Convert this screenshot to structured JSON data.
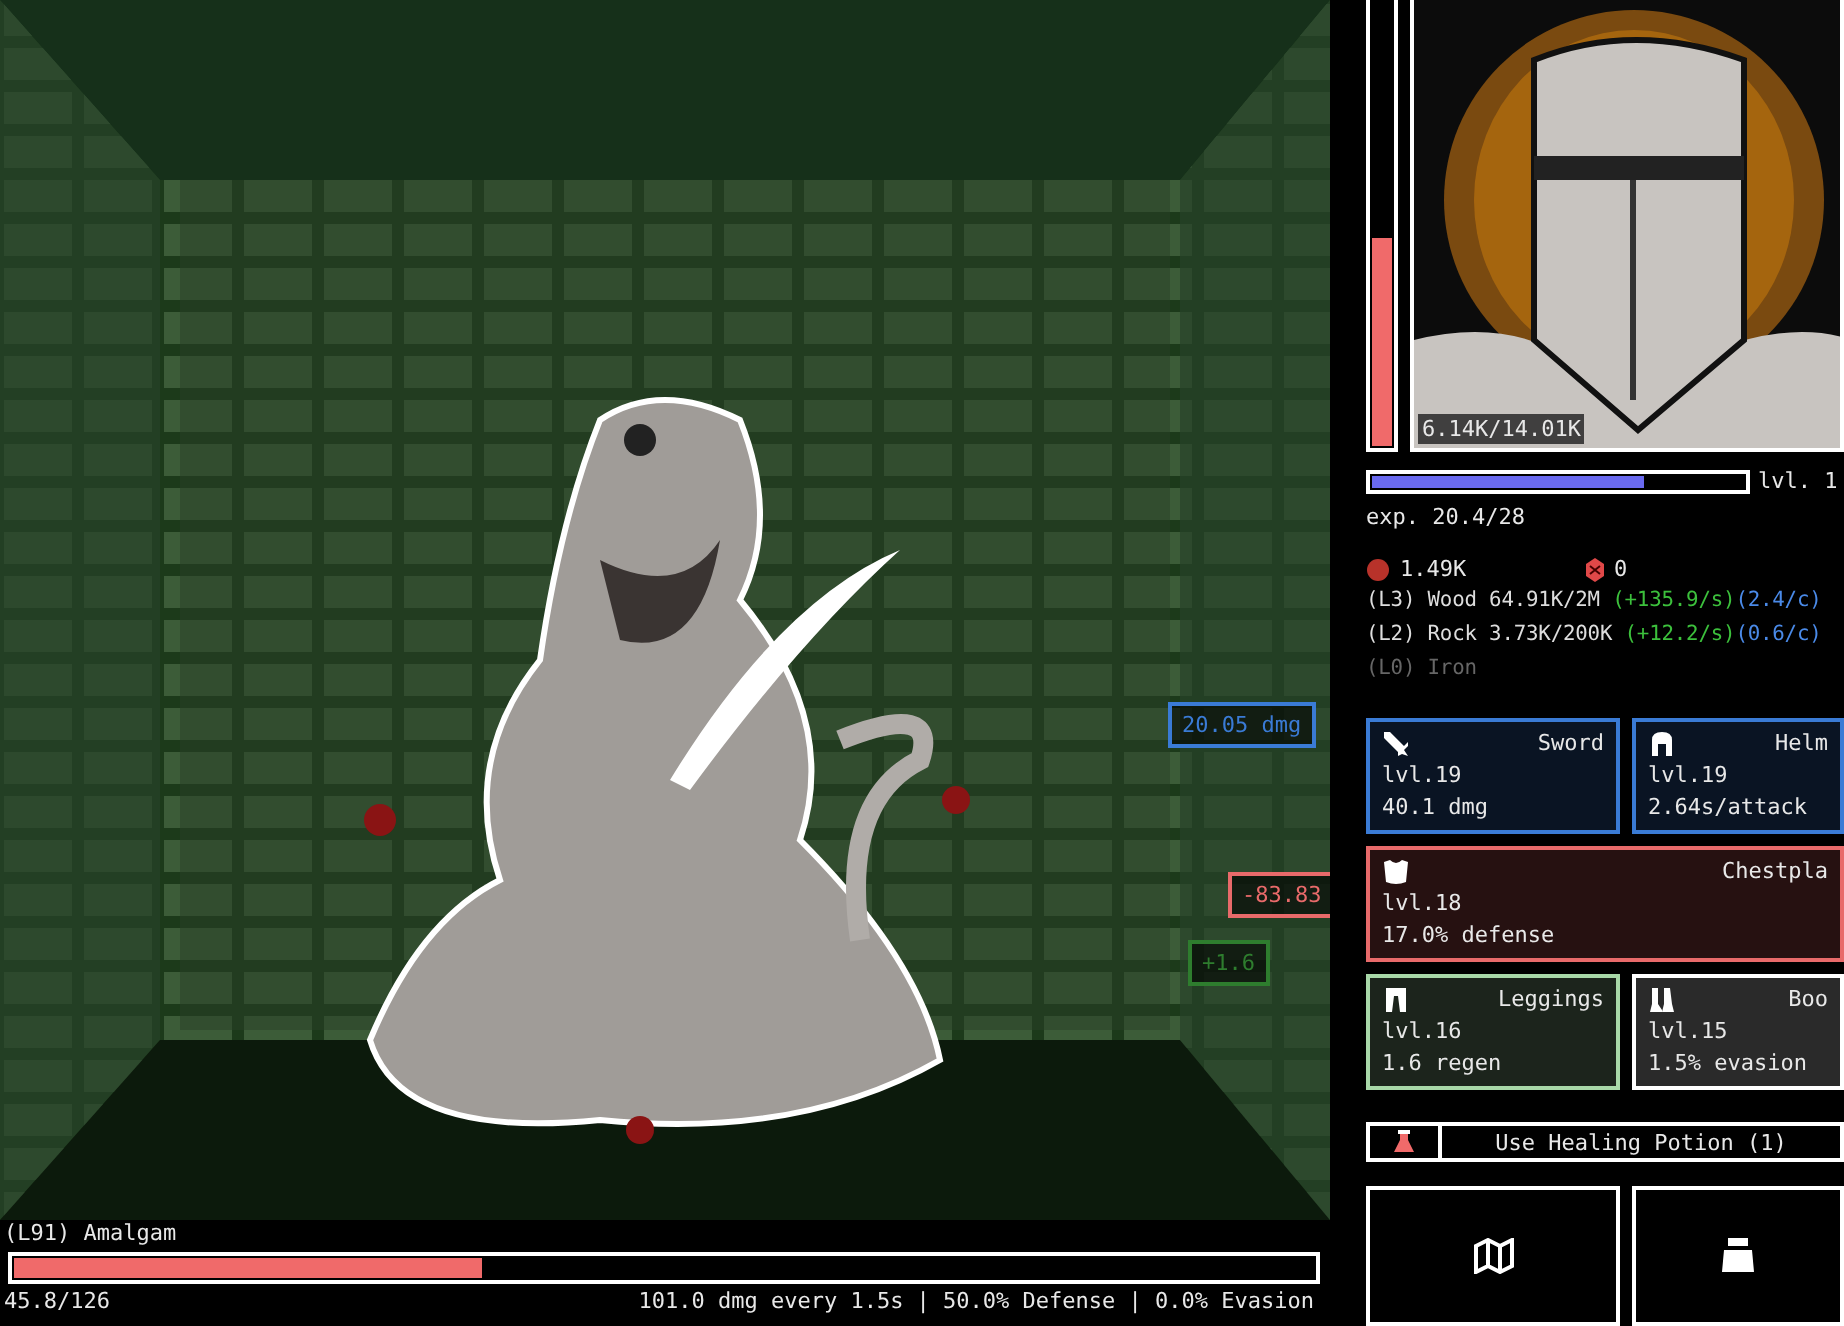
{
  "battle": {
    "popups": [
      {
        "text": "20.05 dmg",
        "color": "#3a7bd5"
      },
      {
        "text": "-83.83",
        "color": "#e86a6a"
      },
      {
        "text": "+1.6",
        "color": "#2e7d2e"
      }
    ],
    "enemy": {
      "name": "(L91) Amalgam",
      "health": {
        "level": 0.36,
        "reading": "45.8/126"
      },
      "stats": "101.0 dmg every 1.5s | 50.0% Defense | 0.0% Evasion"
    }
  },
  "player": {
    "health": {
      "level": 0.47,
      "reading": "6.14K/14.01K"
    },
    "exp": {
      "level": 0.73,
      "rank": "lvl. 1",
      "reading": "exp. 20.4/28"
    }
  },
  "currencies": [
    {
      "kind": "blood",
      "amount": "1.49K"
    },
    {
      "kind": "gem",
      "amount": "0"
    }
  ],
  "resources": [
    {
      "tier": "(L3)",
      "name": "Wood",
      "amount": "64.91K/2M",
      "rate": "(+135.9/s)",
      "per_click": "(2.4/c)",
      "disabled": false
    },
    {
      "tier": "(L2)",
      "name": "Rock",
      "amount": "3.73K/200K",
      "rate": "(+12.2/s)",
      "per_click": "(0.6/c)",
      "disabled": false
    },
    {
      "tier": "(L0)",
      "name": "Iron",
      "disabled": true
    }
  ],
  "equipment": [
    {
      "kind": "sword",
      "name": "Sword",
      "rank": "lvl.19",
      "stat": "40.1 dmg",
      "color": "#3a7bd5",
      "wide": false
    },
    {
      "kind": "helm",
      "name": "Helm",
      "rank": "lvl.19",
      "stat": "2.64s/attack",
      "color": "#3a7bd5",
      "wide": false
    },
    {
      "kind": "chest",
      "name": "Chestpla",
      "rank": "lvl.18",
      "stat": "17.0% defense",
      "color": "#e86a6a",
      "wide": true
    },
    {
      "kind": "legs",
      "name": "Leggings",
      "rank": "lvl.16",
      "stat": "1.6 regen",
      "color": "#a8d8a8",
      "wide": false
    },
    {
      "kind": "boots",
      "name": "Boo",
      "rank": "lvl.15",
      "stat": "1.5% evasion",
      "color": "#ffffff",
      "wide": false
    }
  ],
  "potion_button": {
    "label": "Use Healing Potion (1)"
  }
}
